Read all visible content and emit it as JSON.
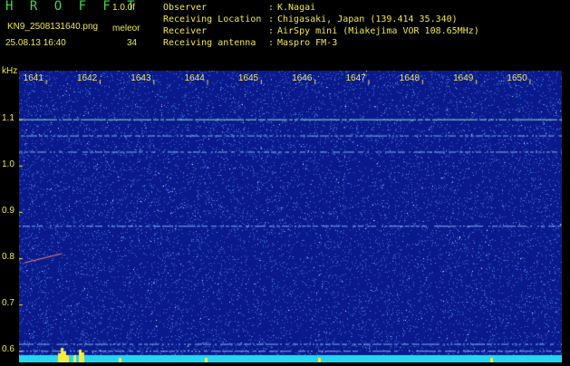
{
  "header": {
    "app_title": "H R O F F T",
    "version": "1.0.0f",
    "filename": "KN9_2508131640.png",
    "mode": "meleor",
    "timestamp": "25.08.13 16:40",
    "count": "34",
    "info": [
      {
        "key": "Observer",
        "value": "K.Nagai"
      },
      {
        "key": "Receiving Location",
        "value": "Chigasaki, Japan (139.414 35.340)"
      },
      {
        "key": "Receiver",
        "value": "AirSpy mini (Miakejima VOR 108.65MHz)"
      },
      {
        "key": "Receiving antenna",
        "value": "Maspro FM-3"
      }
    ],
    "separator": ":"
  },
  "spectrogram": {
    "y_unit": "kHz",
    "x_ticks": [
      "1641",
      "1642",
      "1643",
      "1644",
      "1645",
      "1646",
      "1647",
      "1648",
      "1649",
      "1650"
    ],
    "x_tick_minutes": [
      1641,
      1642,
      1643,
      1644,
      1645,
      1646,
      1647,
      1648,
      1649,
      1650
    ],
    "x_range": [
      1640.5,
      1650.6
    ],
    "y_ticks": [
      "1.1",
      "1.0",
      "0.9",
      "0.8",
      "0.7",
      "0.6"
    ],
    "y_tick_values": [
      1.1,
      1.0,
      0.9,
      0.8,
      0.7,
      0.6
    ],
    "y_range": [
      0.575,
      1.205
    ],
    "background_color": "#0a1a8c",
    "noise_color": "#3a6bd8",
    "bottom_bar_color": "#22d8f0",
    "carrier_lines_khz": [
      1.1,
      1.065,
      1.03,
      0.87,
      0.615,
      0.6
    ],
    "meteor_streak": {
      "x_start": 1640.6,
      "y_start": 0.79,
      "x_end": 1641.3,
      "y_end": 0.81
    }
  }
}
